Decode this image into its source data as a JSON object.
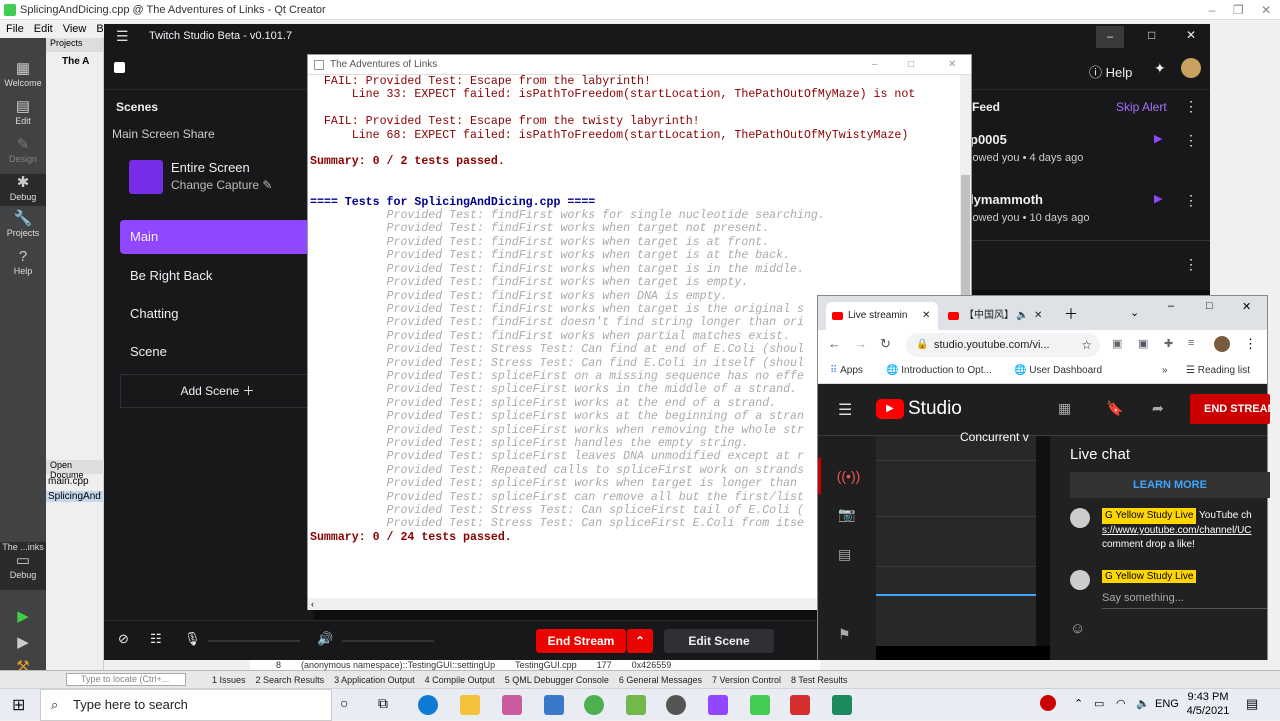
{
  "qt": {
    "title": "SplicingAndDicing.cpp @ The Adventures of Links - Qt Creator",
    "menu": [
      "File",
      "Edit",
      "View",
      "Bu"
    ],
    "modes": [
      "Welcome",
      "Edit",
      "Design",
      "Debug",
      "Projects",
      "Help"
    ],
    "projects_label": "Projects",
    "project_root": "The A",
    "open_docs_label": "Open Docume",
    "open_docs": [
      "main.cpp",
      "SplicingAnd"
    ],
    "kit_label": "The ...inks",
    "kit_sub": "Debug",
    "bottom_tabs": [
      "1 Issues",
      "2 Search Results",
      "3 Application Output",
      "4 Compile Output",
      "5 QML Debugger Console",
      "6 General Messages",
      "7 Version Control",
      "8 Test Results"
    ],
    "locate_placeholder": "Type to locate (Ctrl+...",
    "stack_row": [
      "8",
      "(anonymous namespace)::TestingGUI::settingUp",
      "TestingGUI.cpp",
      "177",
      "0x426559"
    ]
  },
  "twitch": {
    "title": "Twitch Studio Beta - v0.101.7",
    "help": "Help",
    "scenes_label": "Scenes",
    "share_label": "Main Screen Share",
    "capture_title": "Entire Screen",
    "capture_sub": "Change Capture",
    "scenes": [
      "Main",
      "Be Right Back",
      "Chatting",
      "Scene"
    ],
    "add_scene": "Add Scene",
    "feed_label": "Feed",
    "skip_alert": "Skip Alert",
    "feed_items": [
      {
        "name": "p0005",
        "text": "lowed you",
        "time": "4 days ago"
      },
      {
        "name": "lymammoth",
        "text": "lowed you",
        "time": "10 days ago"
      }
    ],
    "end_stream": "End Stream",
    "edit_scene": "Edit Scene"
  },
  "console": {
    "title": "The Adventures of Links",
    "lines": [
      {
        "c": "fail",
        "t": "  FAIL: Provided Test: Escape from the labyrinth!"
      },
      {
        "c": "fail",
        "t": "      Line 33: EXPECT failed: isPathToFreedom(startLocation, ThePathOutOfMyMaze) is not"
      },
      {
        "c": "",
        "t": ""
      },
      {
        "c": "fail",
        "t": "  FAIL: Provided Test: Escape from the twisty labyrinth!"
      },
      {
        "c": "fail",
        "t": "      Line 68: EXPECT failed: isPathToFreedom(startLocation, ThePathOutOfMyTwistyMaze)"
      },
      {
        "c": "",
        "t": ""
      },
      {
        "c": "sum",
        "t": "Summary: 0 / 2 tests passed."
      },
      {
        "c": "",
        "t": ""
      },
      {
        "c": "",
        "t": ""
      },
      {
        "c": "hdr",
        "t": "==== Tests for SplicingAndDicing.cpp ===="
      },
      {
        "c": "pass",
        "t": "           Provided Test: findFirst works for single nucleotide searching."
      },
      {
        "c": "pass",
        "t": "           Provided Test: findFirst works when target not present."
      },
      {
        "c": "pass",
        "t": "           Provided Test: findFirst works when target is at front."
      },
      {
        "c": "pass",
        "t": "           Provided Test: findFirst works when target is at the back."
      },
      {
        "c": "pass",
        "t": "           Provided Test: findFirst works when target is in the middle."
      },
      {
        "c": "pass",
        "t": "           Provided Test: findFirst works when target is empty."
      },
      {
        "c": "pass",
        "t": "           Provided Test: findFirst works when DNA is empty."
      },
      {
        "c": "pass",
        "t": "           Provided Test: findFirst works when target is the original s"
      },
      {
        "c": "pass",
        "t": "           Provided Test: findFirst doesn't find string longer than ori"
      },
      {
        "c": "pass",
        "t": "           Provided Test: findFirst works when partial matches exist."
      },
      {
        "c": "pass",
        "t": "           Provided Test: Stress Test: Can find at end of E.Coli (shoul"
      },
      {
        "c": "pass",
        "t": "           Provided Test: Stress Test: Can find E.Coli in itself (shoul"
      },
      {
        "c": "pass",
        "t": "           Provided Test: spliceFirst on a missing sequence has no effe"
      },
      {
        "c": "pass",
        "t": "           Provided Test: spliceFirst works in the middle of a strand."
      },
      {
        "c": "pass",
        "t": "           Provided Test: spliceFirst works at the end of a strand."
      },
      {
        "c": "pass",
        "t": "           Provided Test: spliceFirst works at the beginning of a stran"
      },
      {
        "c": "pass",
        "t": "           Provided Test: spliceFirst works when removing the whole str"
      },
      {
        "c": "pass",
        "t": "           Provided Test: spliceFirst handles the empty string."
      },
      {
        "c": "pass",
        "t": "           Provided Test: spliceFirst leaves DNA unmodified except at r"
      },
      {
        "c": "pass",
        "t": "           Provided Test: Repeated calls to spliceFirst work on strands"
      },
      {
        "c": "pass",
        "t": "           Provided Test: spliceFirst works when target is longer than"
      },
      {
        "c": "pass",
        "t": "           Provided Test: spliceFirst can remove all but the first/list"
      },
      {
        "c": "pass",
        "t": "           Provided Test: Stress Test: Can spliceFirst tail of E.Coli ("
      },
      {
        "c": "pass",
        "t": "           Provided Test: Stress Test: Can spliceFirst E.Coli from itse"
      },
      {
        "c": "sum",
        "t": "Summary: 0 / 24 tests passed."
      }
    ]
  },
  "chrome": {
    "tab1": "Live streamin",
    "tab2": "【中国风】",
    "url": "studio.youtube.com/vi...",
    "bookmarks": [
      "Apps",
      "Introduction to Opt...",
      "User Dashboard"
    ],
    "reading_list": "Reading list",
    "yt_logo": "Studio",
    "end_stream": "END STREAM",
    "concurrent": "Concurrent v",
    "live_chat": "Live chat",
    "learn_more": "LEARN MORE",
    "chat_user": "G Yellow Study Live",
    "chat_msg": "YouTube ch",
    "chat_link": "s://www.youtube.com/channel/UC",
    "chat_msg2": "comment drop a like!",
    "say_something": "Say something..."
  },
  "taskbar": {
    "search": "Type here to search",
    "lang": "ENG",
    "time": "9:43 PM",
    "date": "4/5/2021"
  },
  "colors": {
    "twitch_purple": "#9147ff",
    "stream_red": "#eb0400",
    "yt_red": "#cc0000"
  }
}
